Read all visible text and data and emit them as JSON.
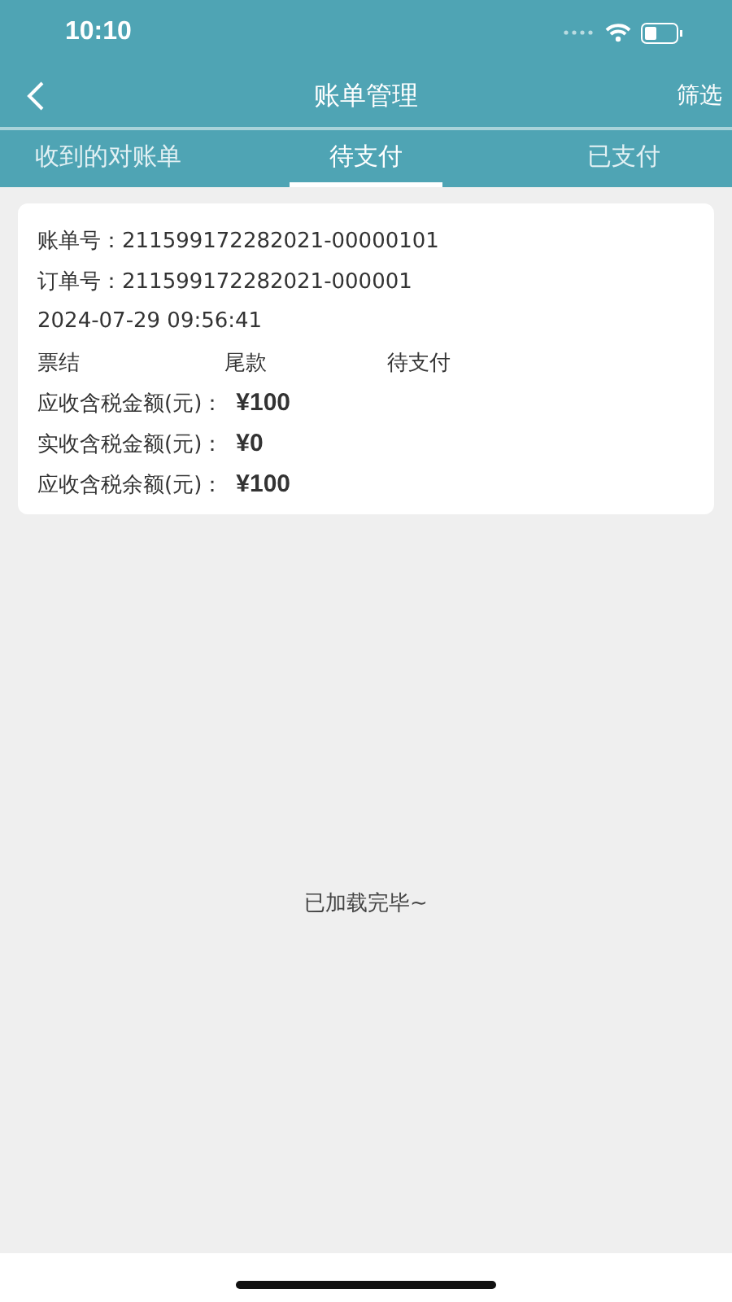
{
  "status_bar": {
    "time": "10:10"
  },
  "nav": {
    "title": "账单管理",
    "action": "筛选"
  },
  "tabs": [
    {
      "label": "收到的对账单",
      "selected": false
    },
    {
      "label": "待支付",
      "selected": true
    },
    {
      "label": "已支付",
      "selected": false
    }
  ],
  "bills": [
    {
      "bill_no": "账单号：211599172282021-00000101",
      "order_no": "订单号：211599172282021-000001",
      "time": "2024-07-29 09:56:41",
      "tags": [
        "票结",
        "尾款",
        "待支付"
      ],
      "amounts": [
        {
          "label": "应收含税金额(元)：",
          "value": "¥100"
        },
        {
          "label": "实收含税金额(元)：",
          "value": "¥0"
        },
        {
          "label": "应收含税余额(元)：",
          "value": "¥100"
        }
      ]
    }
  ],
  "footer": "已加载完毕~"
}
